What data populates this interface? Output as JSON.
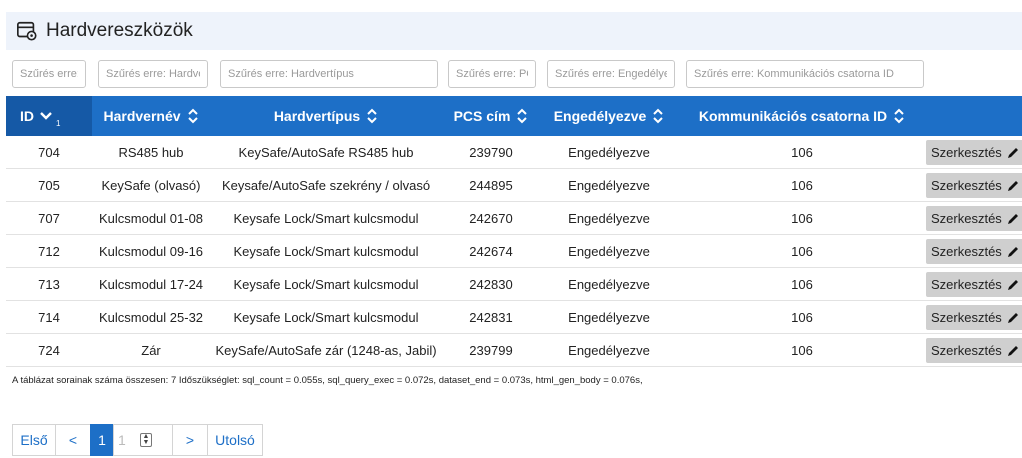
{
  "page": {
    "title": "Hardvereszközök",
    "title_icon": "device-gear-icon"
  },
  "filters": [
    {
      "placeholder": "Szűrés erre: ID"
    },
    {
      "placeholder": "Szűrés erre: Hardvernév"
    },
    {
      "placeholder": "Szűrés erre: Hardvertípus"
    },
    {
      "placeholder": "Szűrés erre: PCS cím"
    },
    {
      "placeholder": "Szűrés erre: Engedélyezve"
    },
    {
      "placeholder": "Szűrés erre: Kommunikációs csatorna ID"
    }
  ],
  "table": {
    "columns": [
      {
        "label": "ID",
        "sort": "desc",
        "sort_order": "1"
      },
      {
        "label": "Hardvernév",
        "sort": "both"
      },
      {
        "label": "Hardvertípus",
        "sort": "both"
      },
      {
        "label": "PCS cím",
        "sort": "both"
      },
      {
        "label": "Engedélyezve",
        "sort": "both"
      },
      {
        "label": "Kommunikációs csatorna ID",
        "sort": "both"
      }
    ],
    "rows": [
      {
        "id": "704",
        "name": "RS485 hub",
        "type": "KeySafe/AutoSafe RS485 hub",
        "pcs": "239790",
        "enabled": "Engedélyezve",
        "channel": "106",
        "edit": "Szerkesztés"
      },
      {
        "id": "705",
        "name": "KeySafe (olvasó)",
        "type": "Keysafe/AutoSafe szekrény / olvasó",
        "pcs": "244895",
        "enabled": "Engedélyezve",
        "channel": "106",
        "edit": "Szerkesztés"
      },
      {
        "id": "707",
        "name": "Kulcsmodul 01-08",
        "type": "Keysafe Lock/Smart kulcsmodul",
        "pcs": "242670",
        "enabled": "Engedélyezve",
        "channel": "106",
        "edit": "Szerkesztés"
      },
      {
        "id": "712",
        "name": "Kulcsmodul 09-16",
        "type": "Keysafe Lock/Smart kulcsmodul",
        "pcs": "242674",
        "enabled": "Engedélyezve",
        "channel": "106",
        "edit": "Szerkesztés"
      },
      {
        "id": "713",
        "name": "Kulcsmodul 17-24",
        "type": "Keysafe Lock/Smart kulcsmodul",
        "pcs": "242830",
        "enabled": "Engedélyezve",
        "channel": "106",
        "edit": "Szerkesztés"
      },
      {
        "id": "714",
        "name": "Kulcsmodul 25-32",
        "type": "Keysafe Lock/Smart kulcsmodul",
        "pcs": "242831",
        "enabled": "Engedélyezve",
        "channel": "106",
        "edit": "Szerkesztés"
      },
      {
        "id": "724",
        "name": "Zár",
        "type": "KeySafe/AutoSafe zár (1248-as, Jabil)",
        "pcs": "239799",
        "enabled": "Engedélyezve",
        "channel": "106",
        "edit": "Szerkesztés"
      }
    ]
  },
  "stats": "A táblázat sorainak száma összesen: 7  Időszükséglet: sql_count = 0.055s, sql_query_exec = 0.072s, dataset_end = 0.073s, html_gen_body = 0.076s,",
  "pager": {
    "first": "Első",
    "prev": "<",
    "current": "1",
    "page_input": "1",
    "next": ">",
    "last": "Utolsó"
  },
  "colors": {
    "header_bg": "#1d6fc7",
    "header_sorted_bg": "#1559a6",
    "title_bg": "#eef3fb",
    "edit_button_bg": "#cfcfcf"
  }
}
